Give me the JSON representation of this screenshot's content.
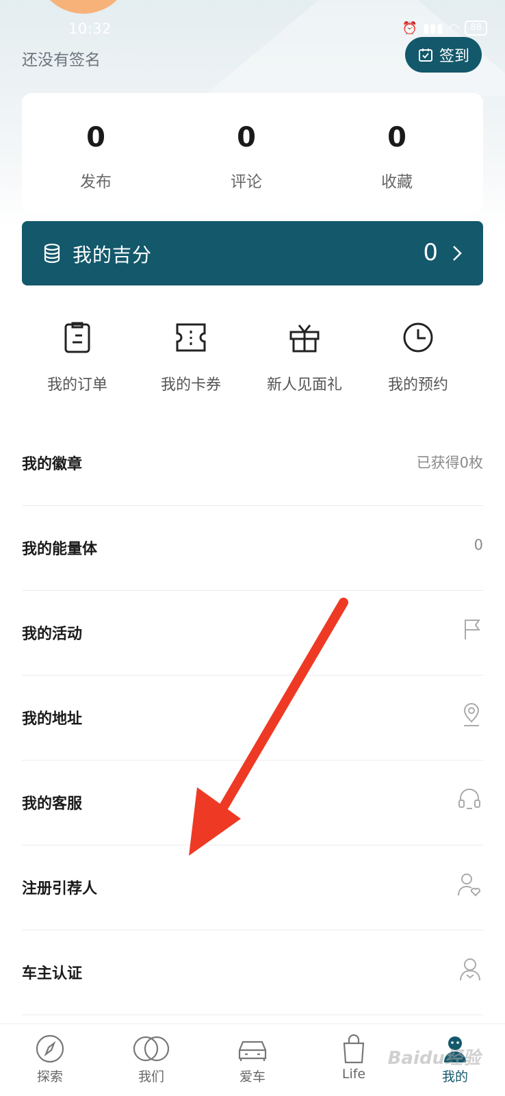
{
  "status_bar": {
    "time": "10:32",
    "battery": "88"
  },
  "profile": {
    "signature": "还没有签名",
    "signin_label": "签到"
  },
  "stats": [
    {
      "value": "0",
      "label": "发布"
    },
    {
      "value": "0",
      "label": "评论"
    },
    {
      "value": "0",
      "label": "收藏"
    }
  ],
  "points": {
    "title": "我的吉分",
    "value": "0"
  },
  "quick_actions": [
    {
      "label": "我的订单",
      "icon": "clipboard-icon"
    },
    {
      "label": "我的卡券",
      "icon": "ticket-icon"
    },
    {
      "label": "新人见面礼",
      "icon": "gift-icon"
    },
    {
      "label": "我的预约",
      "icon": "clock-icon"
    }
  ],
  "menu": [
    {
      "label": "我的徽章",
      "right_text": "已获得0枚"
    },
    {
      "label": "我的能量体",
      "right_text": "0"
    },
    {
      "label": "我的活动",
      "icon": "flag-icon"
    },
    {
      "label": "我的地址",
      "icon": "location-pin-icon"
    },
    {
      "label": "我的客服",
      "icon": "headset-icon"
    },
    {
      "label": "注册引荐人",
      "icon": "user-heart-icon"
    },
    {
      "label": "车主认证",
      "icon": "user-icon"
    }
  ],
  "tabs": [
    {
      "label": "探索",
      "icon": "compass-icon"
    },
    {
      "label": "我们",
      "icon": "rings-icon"
    },
    {
      "label": "爱车",
      "icon": "car-icon"
    },
    {
      "label": "Life",
      "icon": "bag-icon"
    },
    {
      "label": "我的",
      "icon": "mine-icon",
      "active": true
    }
  ],
  "watermark": "Baidu经验",
  "colors": {
    "brand": "#13586b",
    "annotation_arrow": "#ee3a24"
  }
}
